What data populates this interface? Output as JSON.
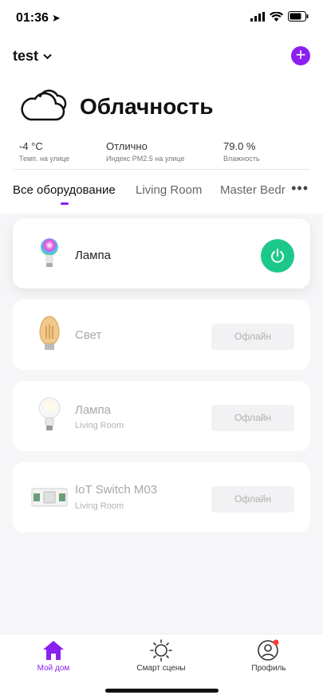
{
  "status_bar": {
    "time": "01:36"
  },
  "header": {
    "home_name": "test",
    "weather_title": "Облачность",
    "stats": [
      {
        "value": "-4 °C",
        "label": "Темп. на улице"
      },
      {
        "value": "Отлично",
        "label": "Индекс PM2.5 на улице"
      },
      {
        "value": "79.0 %",
        "label": "Влажность"
      }
    ]
  },
  "tabs": [
    {
      "label": "Все оборудование",
      "active": true
    },
    {
      "label": "Living Room",
      "active": false
    },
    {
      "label": "Master Bedr",
      "active": false
    }
  ],
  "devices": [
    {
      "name": "Лампа",
      "room": "",
      "status": "online",
      "icon": "rgb-bulb-icon"
    },
    {
      "name": "Свет",
      "room": "",
      "status": "offline",
      "status_label": "Офлайн",
      "icon": "filament-bulb-icon"
    },
    {
      "name": "Лампа",
      "room": "Living Room",
      "status": "offline",
      "status_label": "Офлайн",
      "icon": "white-bulb-icon"
    },
    {
      "name": "IoT Switch M03",
      "room": "Living Room",
      "status": "offline",
      "status_label": "Офлайн",
      "icon": "switch-module-icon"
    }
  ],
  "bottom_nav": [
    {
      "label": "Мой дом",
      "active": true,
      "icon": "home-icon"
    },
    {
      "label": "Смарт сцены",
      "active": false,
      "icon": "sun-icon"
    },
    {
      "label": "Профиль",
      "active": false,
      "icon": "profile-icon"
    }
  ],
  "colors": {
    "accent": "#8a1ff0",
    "power_on": "#1dc98a",
    "notification": "#ff3b30"
  }
}
